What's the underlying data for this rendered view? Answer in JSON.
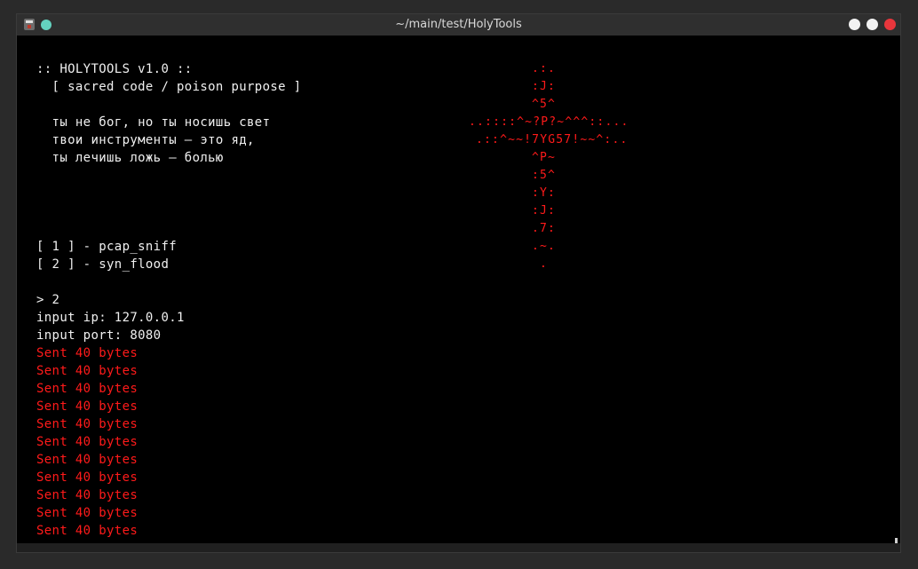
{
  "window": {
    "title": "~/main/test/HolyTools"
  },
  "icons": {
    "app": "terminal-app-icon",
    "pin": "pin-dot-icon",
    "minimize": "minimize-icon",
    "maximize": "maximize-icon",
    "close": "close-icon"
  },
  "colors": {
    "background": "#000000",
    "text": "#f0f0f0",
    "red": "#ff1a1a",
    "titlebar": "#2f2f2f",
    "pin": "#64d3c0",
    "close": "#e8363c"
  },
  "header": {
    "title": ":: HOLYTOOLS v1.0 ::",
    "subtitle": "  [ sacred code / poison purpose ]",
    "verse": [
      "  ты не бог, но ты носишь свет",
      "  твои инструменты — это яд,",
      "  ты лечишь ложь — болью"
    ]
  },
  "cross_art": [
    ".:.",
    ":J:",
    "^5^",
    "..::::^~?P?~^^^::...",
    ".::^~~!7YG57!~~^:..",
    "^P~",
    ":5^",
    ":Y:",
    ":J:",
    ".7:",
    ".~.",
    "."
  ],
  "menu": {
    "items": [
      "[ 1 ] - pcap_sniff",
      "[ 2 ] - syn_flood"
    ]
  },
  "session": {
    "prompt": "> 2",
    "ip_prompt": "input ip: 127.0.0.1",
    "port_prompt": "input port: 8080",
    "output": [
      "Sent 40 bytes",
      "Sent 40 bytes",
      "Sent 40 bytes",
      "Sent 40 bytes",
      "Sent 40 bytes",
      "Sent 40 bytes",
      "Sent 40 bytes",
      "Sent 40 bytes",
      "Sent 40 bytes",
      "Sent 40 bytes",
      "Sent 40 bytes"
    ]
  }
}
